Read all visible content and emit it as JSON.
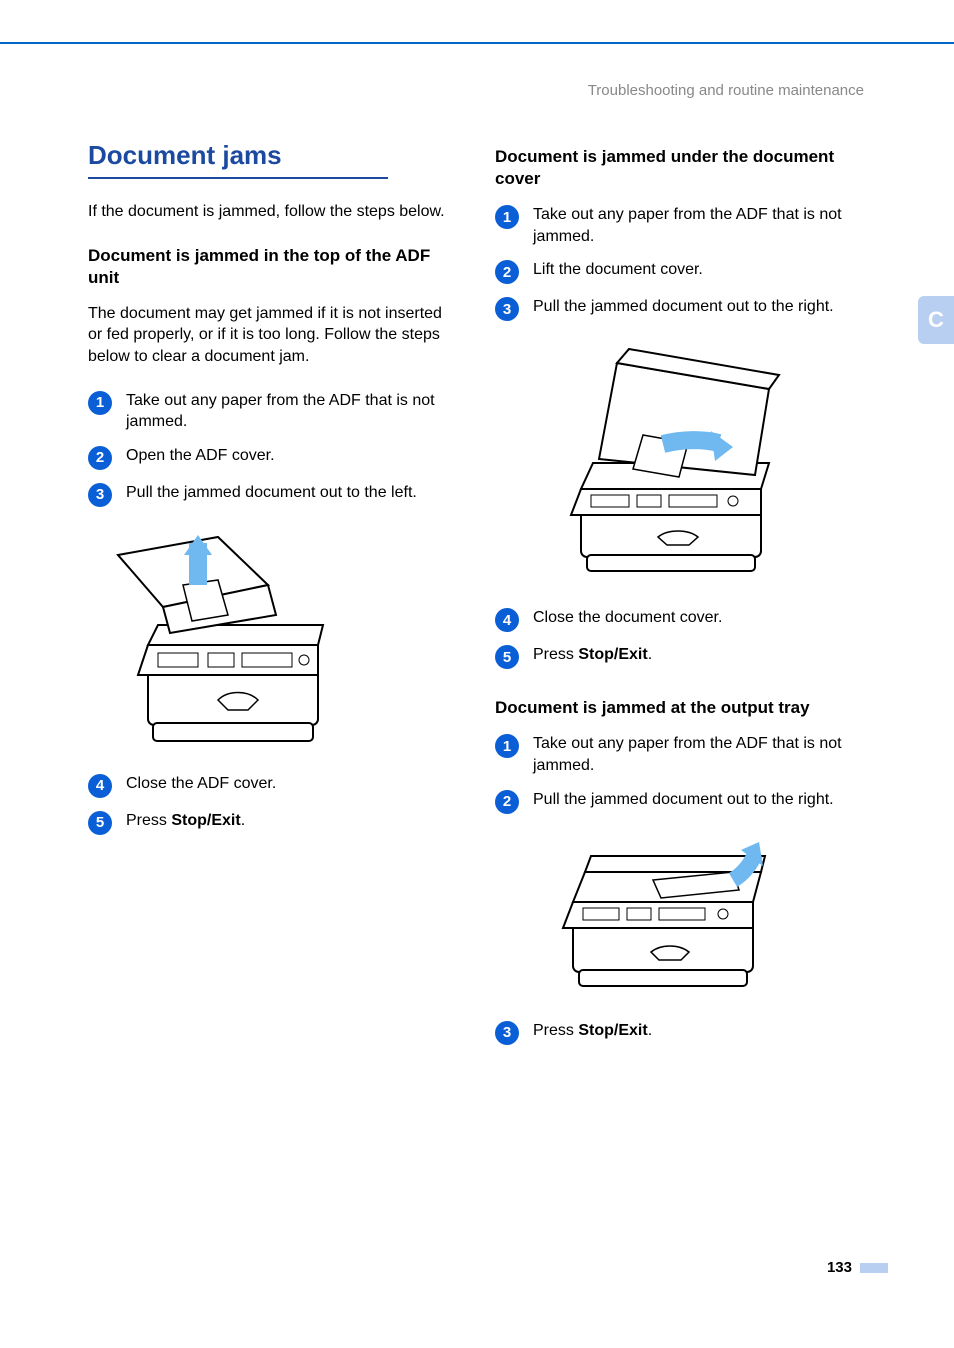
{
  "header": {
    "running_title": "Troubleshooting and routine maintenance"
  },
  "section_tab": "C",
  "page_number": "133",
  "left_column": {
    "main_heading": "Document jams",
    "intro": "If the document is jammed, follow the steps below.",
    "section_a": {
      "heading": "Document is jammed in the top of the ADF unit",
      "intro": "The document may get jammed if it is not inserted or fed properly, or if it is too long. Follow the steps below to clear a document jam.",
      "steps": [
        "Take out any paper from the ADF that is not jammed.",
        "Open the ADF cover.",
        "Pull the jammed document out to the left."
      ],
      "post_steps": [
        "Close the ADF cover."
      ],
      "press_step_prefix": "Press ",
      "press_step_bold": "Stop/Exit",
      "press_step_suffix": "."
    }
  },
  "right_column": {
    "section_b": {
      "heading": "Document is jammed under the document cover",
      "steps": [
        "Take out any paper from the ADF that is not jammed.",
        "Lift the document cover.",
        "Pull the jammed document out to the right."
      ],
      "post_steps": [
        "Close the document cover."
      ],
      "press_step_prefix": "Press ",
      "press_step_bold": "Stop/Exit",
      "press_step_suffix": "."
    },
    "section_c": {
      "heading": "Document is jammed at the output tray",
      "steps": [
        "Take out any paper from the ADF that is not jammed.",
        "Pull the jammed document out to the right."
      ],
      "press_step_prefix": "Press ",
      "press_step_bold": "Stop/Exit",
      "press_step_suffix": "."
    }
  }
}
